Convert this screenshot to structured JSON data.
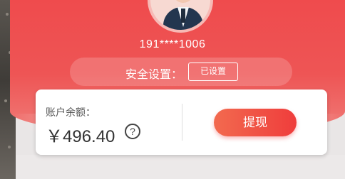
{
  "header": {
    "phone": "191****1006"
  },
  "security": {
    "label": "安全设置：",
    "status_button": "已设置"
  },
  "balance": {
    "label": "账户余额：",
    "amount": "￥496.40",
    "help_icon_glyph": "?",
    "withdraw_button": "提现"
  },
  "colors": {
    "primary_red": "#ef4b4d",
    "button_gradient_start": "#f26a4f",
    "button_gradient_end": "#ef3d3c"
  },
  "icons": [
    "avatar",
    "question-circle-icon"
  ]
}
